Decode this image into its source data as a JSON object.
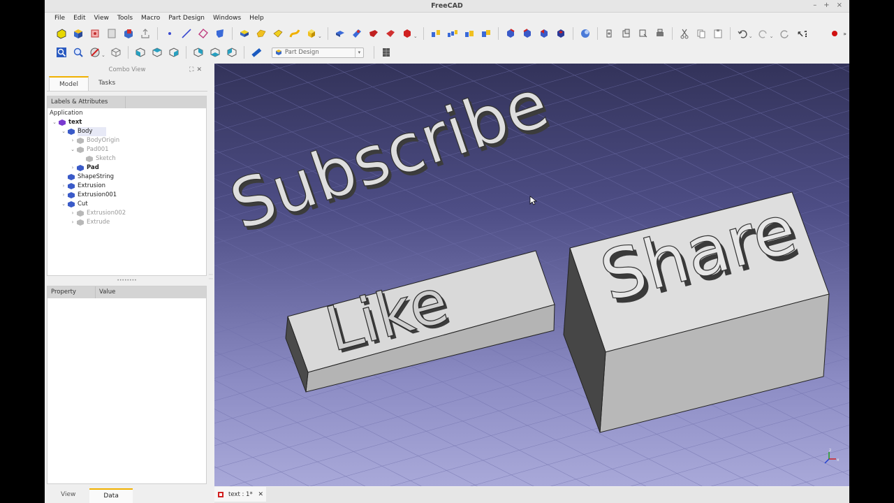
{
  "window": {
    "title": "FreeCAD"
  },
  "menu": [
    "File",
    "Edit",
    "View",
    "Tools",
    "Macro",
    "Part Design",
    "Windows",
    "Help"
  ],
  "workbench": {
    "selected": "Part Design"
  },
  "combo": {
    "title": "Combo View",
    "tabs": [
      "Model",
      "Tasks"
    ],
    "tree_columns": [
      "Labels & Attributes",
      ""
    ],
    "root": "Application",
    "tree": [
      {
        "label": "text",
        "level": 0,
        "expanded": true,
        "bold": true
      },
      {
        "label": "Body",
        "level": 1,
        "expanded": true,
        "selected": true
      },
      {
        "label": "BodyOrigin",
        "level": 2,
        "dim": true
      },
      {
        "label": "Pad001",
        "level": 2,
        "expanded": true,
        "dim": true
      },
      {
        "label": "Sketch",
        "level": 3,
        "dim": true
      },
      {
        "label": "Pad",
        "level": 2,
        "bold": true
      },
      {
        "label": "ShapeString",
        "level": 1
      },
      {
        "label": "Extrusion",
        "level": 1
      },
      {
        "label": "Extrusion001",
        "level": 1
      },
      {
        "label": "Cut",
        "level": 1,
        "expanded": true
      },
      {
        "label": "Extrusion002",
        "level": 2,
        "dim": true
      },
      {
        "label": "Extrude",
        "level": 2,
        "dim": true
      }
    ],
    "property_columns": [
      "Property",
      "Value"
    ],
    "bottom_tabs": [
      "View",
      "Data"
    ]
  },
  "scene": {
    "word_top": "Subscribe",
    "word_left": "Like",
    "word_right": "Share"
  },
  "document_tab": {
    "label": "text : 1*"
  },
  "colors": {
    "accent": "#f0b000",
    "bg_top": "#33335a",
    "bg_bottom": "#a9a9d9"
  }
}
